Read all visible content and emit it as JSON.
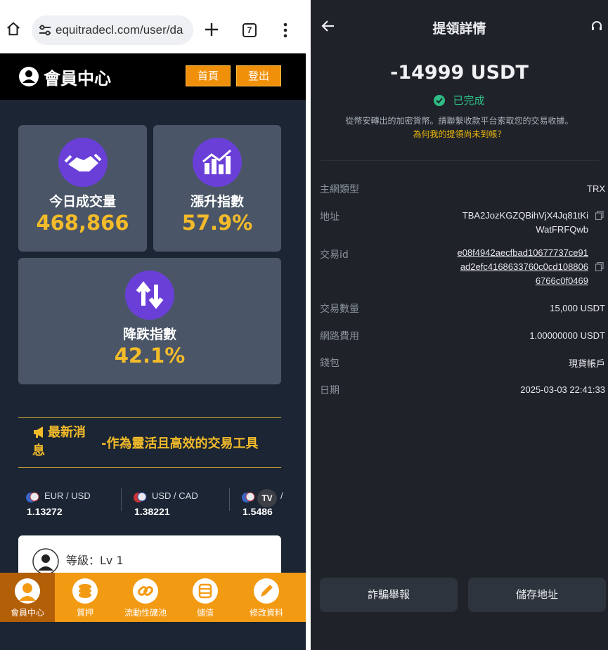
{
  "left": {
    "browser": {
      "url": "equitradecl.com/user/da",
      "tab_count": "7"
    },
    "header": {
      "title": "會員中心",
      "home_label": "首頁",
      "logout_label": "登出"
    },
    "stats": [
      {
        "label": "今日成交量",
        "value": "468,866"
      },
      {
        "label": "漲升指數",
        "value": "57.9%"
      },
      {
        "label": "降跌指數",
        "value": "42.1%"
      }
    ],
    "news": {
      "title": "最新消息",
      "text": "-作為靈活且高效的交易工具"
    },
    "tickers": [
      {
        "pair": "EUR / USD",
        "price": "1.13272"
      },
      {
        "pair": "USD / CAD",
        "price": "1.38221"
      },
      {
        "pair": "/",
        "price": "1.5486"
      }
    ],
    "tradingview_logo": "TV",
    "level": "等級：Lv 1",
    "nav": [
      {
        "label": "會員中心"
      },
      {
        "label": "質押"
      },
      {
        "label": "流動性礦池"
      },
      {
        "label": "儲值"
      },
      {
        "label": "修改資料"
      }
    ],
    "colors": {
      "accent": "#f39a13",
      "gold": "#f3bb2a",
      "purple": "#6a3fd8"
    }
  },
  "right": {
    "title": "提領詳情",
    "amount": "-14999 USDT",
    "status": "已完成",
    "info": "從幣安轉出的加密貨幣。請聯繫收款平台索取您的交易收據。",
    "why_link": "為何我的提領尚未到帳？",
    "rows": {
      "network": {
        "label": "主網類型",
        "value": "TRX"
      },
      "address": {
        "label": "地址",
        "line1": "TBA2JozKGZQBihVjX4Jq81tKi",
        "line2": "WatFRFQwb"
      },
      "txid": {
        "label": "交易id",
        "line1": "e08f4942aecfbad10677737ce91",
        "line2": "ad2efc4168633760c0cd108806",
        "line3": "6766c0f0469"
      },
      "quantity": {
        "label": "交易數量",
        "value": "15,000 USDT"
      },
      "fee": {
        "label": "網路費用",
        "value": "1.00000000 USDT"
      },
      "wallet": {
        "label": "錢包",
        "value": "現貨帳戶"
      },
      "date": {
        "label": "日期",
        "value": "2025-03-03 22:41:33"
      }
    },
    "buttons": {
      "report": "詐騙舉報",
      "save_address": "儲存地址"
    },
    "colors": {
      "status_green": "#2ebd85",
      "link_yellow": "#f0b90b",
      "background": "#1f2329"
    }
  }
}
